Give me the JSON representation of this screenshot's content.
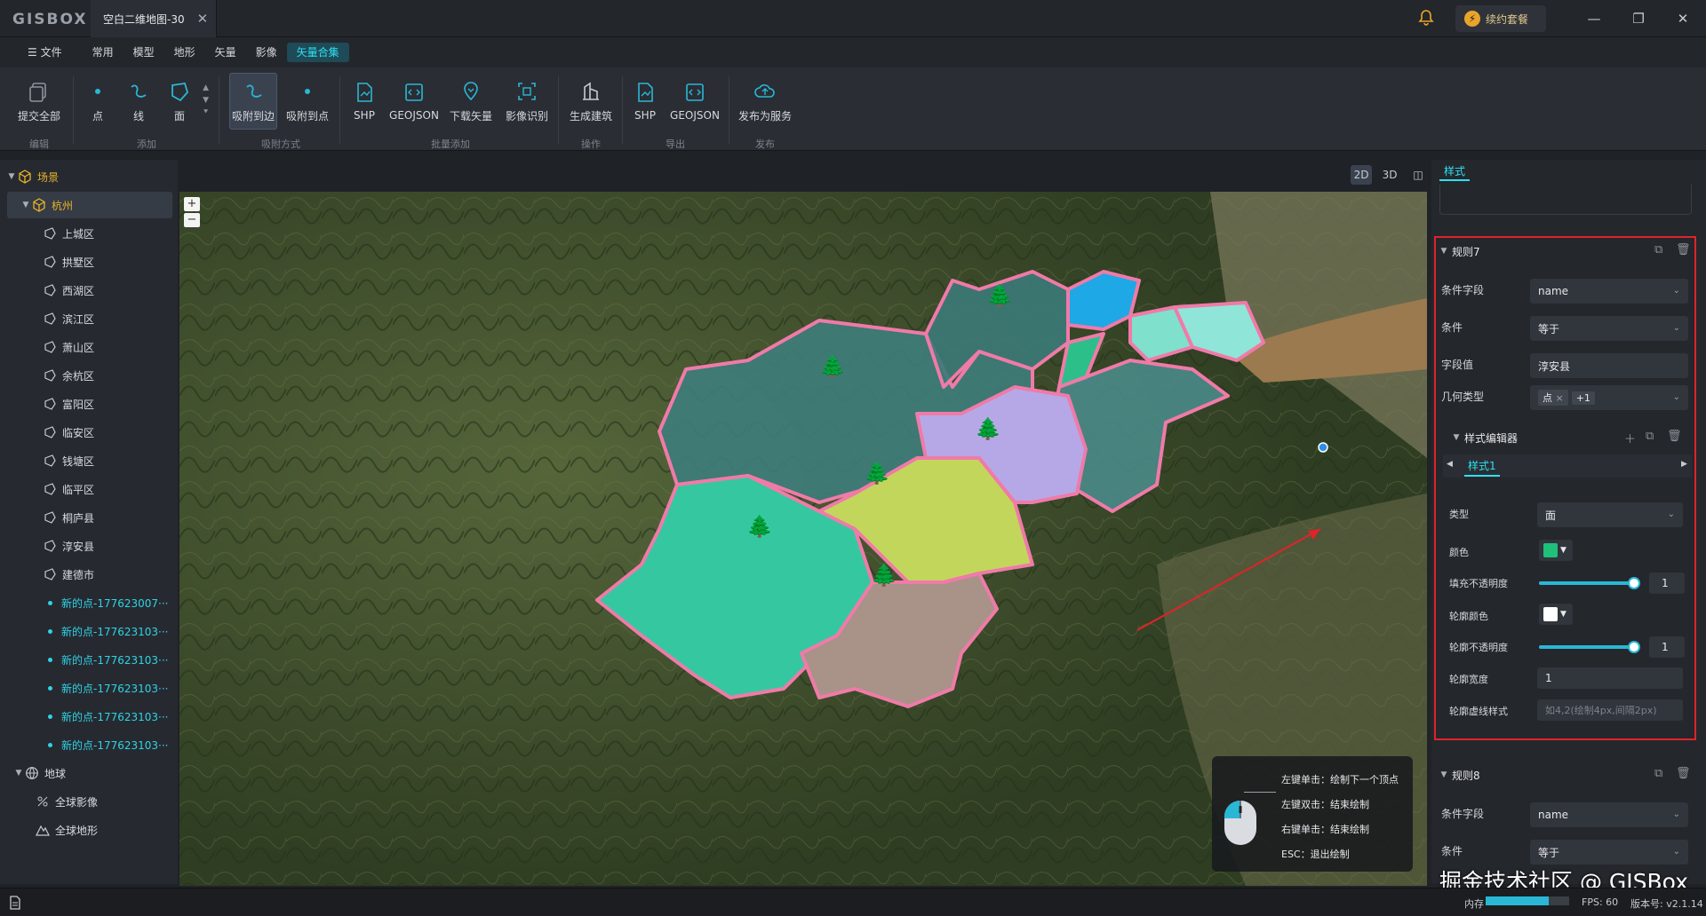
{
  "app": {
    "logo": "GISBOX",
    "doc_tab": "空白二维地图-30",
    "renew_label": "续约套餐"
  },
  "menu": {
    "file": "☰ 文件",
    "items": [
      "常用",
      "模型",
      "地形",
      "矢量",
      "影像",
      "矢量合集"
    ],
    "active_index": 5
  },
  "ribbon": {
    "tools": [
      "提交全部",
      "点",
      "线",
      "面",
      "吸附到边",
      "吸附到点",
      "SHP",
      "GEOJSON",
      "下载矢量",
      "影像识别",
      "生成建筑",
      "SHP",
      "GEOJSON",
      "发布为服务"
    ],
    "groups": [
      "编辑",
      "添加",
      "吸附方式",
      "批量添加",
      "操作",
      "导出",
      "发布"
    ]
  },
  "tree": {
    "scene": "场景",
    "city": "杭州",
    "districts": [
      "上城区",
      "拱墅区",
      "西湖区",
      "滨江区",
      "萧山区",
      "余杭区",
      "富阳区",
      "临安区",
      "钱塘区",
      "临平区",
      "桐庐县",
      "淳安县",
      "建德市"
    ],
    "points": [
      "新的点-177623007···",
      "新的点-177623103···",
      "新的点-177623103···",
      "新的点-177623103···",
      "新的点-177623103···",
      "新的点-177623103···"
    ],
    "earth": "地球",
    "earth_items": [
      "全球影像",
      "全球地形"
    ]
  },
  "view": {
    "modes": [
      "2D",
      "3D",
      "◫"
    ],
    "active": "2D"
  },
  "map": {
    "zoom_in": "+",
    "zoom_out": "−"
  },
  "hint": {
    "lines": [
      "左键单击：绘制下一个顶点",
      "左键双击：结束绘制",
      "右键单击：结束绘制",
      "ESC：退出绘制"
    ]
  },
  "panel": {
    "tab": "样式",
    "rule7": {
      "title": "规则7",
      "field_label": "条件字段",
      "field_value": "name",
      "cond_label": "条件",
      "cond_value": "等于",
      "val_label": "字段值",
      "val_value": "淳安县",
      "geom_label": "几何类型",
      "geom_tag": "点",
      "geom_more": "+1"
    },
    "style_editor": {
      "title": "样式编辑器",
      "tab": "样式1",
      "type_label": "类型",
      "type_value": "面",
      "color_label": "颜色",
      "fill_color": "#1fc07a",
      "fill_opacity_label": "填充不透明度",
      "fill_opacity": "1",
      "outline_color_label": "轮廓颜色",
      "outline_color": "#ffffff",
      "outline_opacity_label": "轮廓不透明度",
      "outline_opacity": "1",
      "outline_width_label": "轮廓宽度",
      "outline_width": "1",
      "dash_label": "轮廓虚线样式",
      "dash_placeholder": "如4,2(绘制4px,间隔2px)"
    },
    "rule8": {
      "title": "规则8",
      "field_label": "条件字段",
      "field_value": "name",
      "cond_label": "条件",
      "cond_value": "等于"
    }
  },
  "status": {
    "mem_label": "内存",
    "fps": "FPS: 60",
    "version": "版本号: v2.1.14",
    "mem_fill": 0.75
  },
  "watermark": "掘金技术社区 @ GISBox"
}
